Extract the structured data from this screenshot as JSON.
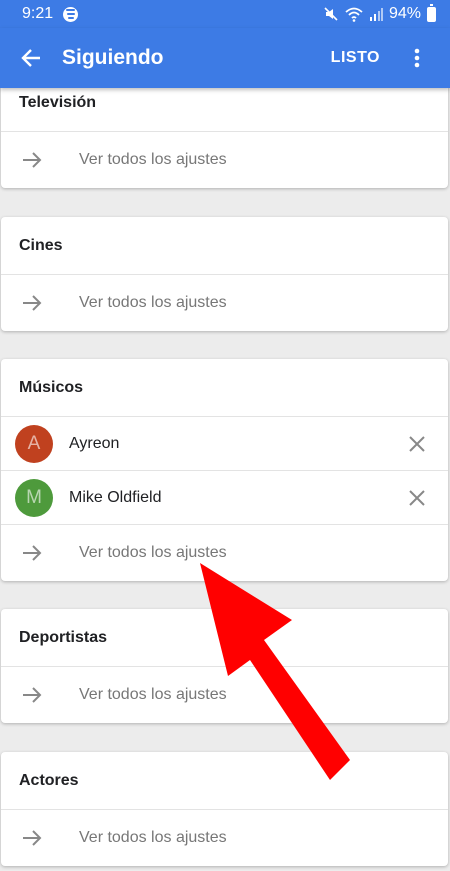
{
  "status_bar": {
    "time": "9:21",
    "battery": "94%"
  },
  "app_bar": {
    "title": "Siguiendo",
    "done_label": "LISTO"
  },
  "sections": [
    {
      "title": "Televisión",
      "see_all": "Ver todos los ajustes"
    },
    {
      "title": "Cines",
      "see_all": "Ver todos los ajustes"
    },
    {
      "title": "Músicos",
      "people": [
        {
          "initial": "A",
          "name": "Ayreon",
          "color": "#c0411f"
        },
        {
          "initial": "M",
          "name": "Mike Oldfield",
          "color": "#4e9a3c"
        }
      ],
      "see_all": "Ver todos los ajustes"
    },
    {
      "title": "Deportistas",
      "see_all": "Ver todos los ajustes"
    },
    {
      "title": "Actores",
      "see_all": "Ver todos los ajustes"
    }
  ],
  "colors": {
    "primary": "#3d7be5",
    "annotation_arrow": "#ff0000"
  }
}
